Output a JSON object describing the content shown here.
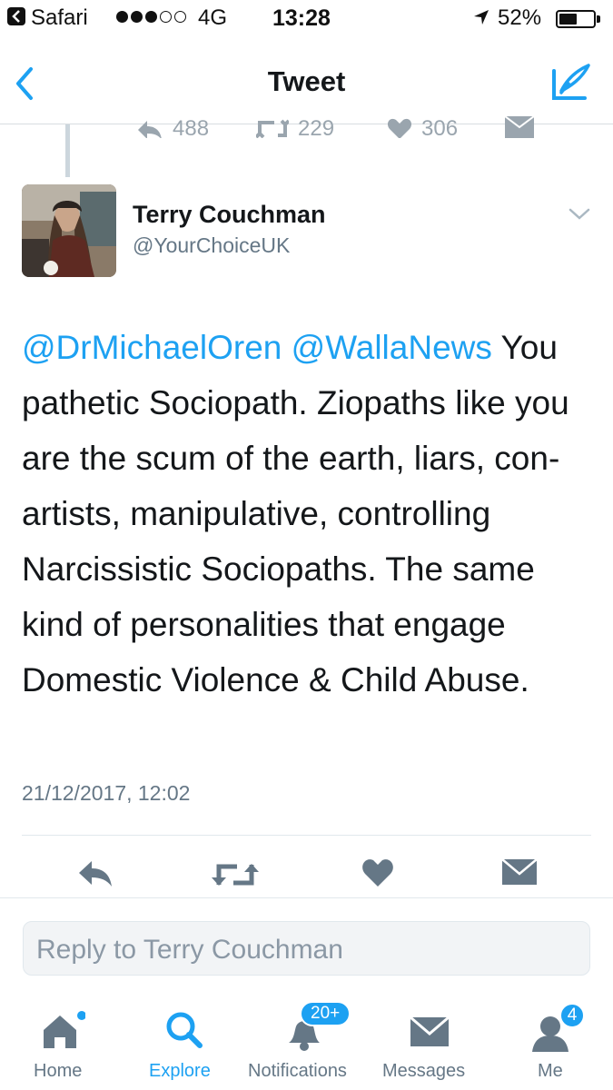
{
  "status_bar": {
    "back_app": "Safari",
    "network": "4G",
    "time": "13:28",
    "battery": "52%",
    "battery_level": 0.52
  },
  "nav": {
    "title": "Tweet",
    "back_icon": "chevron-left-icon",
    "compose_icon": "compose-icon"
  },
  "previous_tweet": {
    "replies": "488",
    "retweets": "229",
    "likes": "306"
  },
  "tweet": {
    "author_name": "Terry Couchman",
    "author_handle": "@YourChoiceUK",
    "mention_1": "@DrMichaelOren",
    "mention_2": "@WallaNews",
    "body": " You pathetic Sociopath. Ziopaths like you are the scum of the earth, liars, con-artists, manipulative, controlling Narcissistic Sociopaths. The same kind of personalities that engage Domestic Violence & Child Abuse.",
    "timestamp": "21/12/2017, 12:02"
  },
  "actions": [
    "reply-icon",
    "retweet-icon",
    "heart-icon",
    "envelope-icon"
  ],
  "reply_box": {
    "placeholder": "Reply to Terry Couchman"
  },
  "tabs": [
    {
      "label": "Home",
      "icon": "home-icon"
    },
    {
      "label": "Explore",
      "icon": "search-icon",
      "active": true
    },
    {
      "label": "Notifications",
      "icon": "bell-icon",
      "badge": "20+"
    },
    {
      "label": "Messages",
      "icon": "envelope-icon"
    },
    {
      "label": "Me",
      "icon": "person-icon",
      "badge": "4"
    }
  ],
  "colors": {
    "accent": "#1da1f2",
    "text": "#14171a",
    "secondary": "#657786",
    "icon": "#657786"
  }
}
